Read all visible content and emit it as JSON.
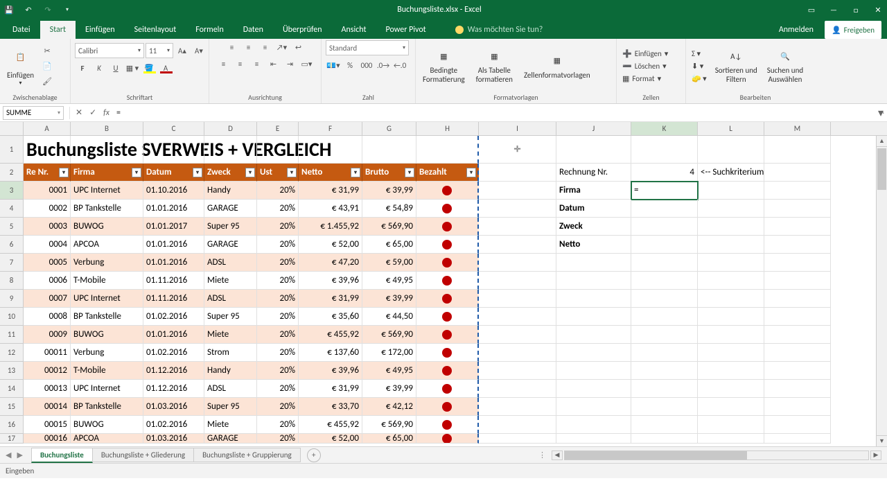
{
  "titlebar": {
    "title": "Buchungsliste.xlsx - Excel"
  },
  "ribbon_tabs": {
    "file": "Datei",
    "tabs": [
      "Start",
      "Einfügen",
      "Seitenlayout",
      "Formeln",
      "Daten",
      "Überprüfen",
      "Ansicht",
      "Power Pivot"
    ],
    "active": "Start",
    "tell_me": "Was möchten Sie tun?",
    "sign_in": "Anmelden",
    "share": "Freigeben"
  },
  "ribbon": {
    "clipboard": {
      "paste": "Einfügen",
      "label": "Zwischenablage"
    },
    "font": {
      "name": "Calibri",
      "size": "11",
      "label": "Schriftart"
    },
    "alignment": {
      "label": "Ausrichtung"
    },
    "number": {
      "format": "Standard",
      "label": "Zahl"
    },
    "styles": {
      "cond": "Bedingte\nFormatierung",
      "table": "Als Tabelle\nformatieren",
      "cell": "Zellenformatvorlagen",
      "label": "Formatvorlagen"
    },
    "cells": {
      "insert": "Einfügen",
      "delete": "Löschen",
      "format": "Format",
      "label": "Zellen"
    },
    "editing": {
      "sort": "Sortieren und\nFiltern",
      "find": "Suchen und\nAuswählen",
      "label": "Bearbeiten"
    }
  },
  "formula_bar": {
    "name": "SUMME",
    "formula": "="
  },
  "columns": [
    "A",
    "B",
    "C",
    "D",
    "E",
    "F",
    "G",
    "H",
    "I",
    "J",
    "K",
    "L",
    "M"
  ],
  "main_title": "Buchungsliste SVERWEIS + VERGLEICH",
  "table_headers": [
    "Re Nr.",
    "Firma",
    "Datum",
    "Zweck",
    "Ust",
    "Netto",
    "Brutto",
    "Bezahlt"
  ],
  "table_rows": [
    {
      "n": "3",
      "nr": "0001",
      "firma": "UPC Internet",
      "datum": "01.10.2016",
      "zweck": "Handy",
      "ust": "20%",
      "netto": "€     31,99",
      "brutto": "€ 39,99",
      "shade": "odd"
    },
    {
      "n": "4",
      "nr": "0002",
      "firma": "BP Tankstelle",
      "datum": "01.01.2016",
      "zweck": "GARAGE",
      "ust": "20%",
      "netto": "€     43,91",
      "brutto": "€ 54,89",
      "shade": "even"
    },
    {
      "n": "5",
      "nr": "0003",
      "firma": "BUWOG",
      "datum": "01.01.2017",
      "zweck": "Super 95",
      "ust": "20%",
      "netto": "€ 1.455,92",
      "brutto": "€ 569,90",
      "shade": "odd"
    },
    {
      "n": "6",
      "nr": "0004",
      "firma": "APCOA",
      "datum": "01.01.2016",
      "zweck": "GARAGE",
      "ust": "20%",
      "netto": "€     52,00",
      "brutto": "€ 65,00",
      "shade": "even"
    },
    {
      "n": "7",
      "nr": "0005",
      "firma": "Verbung",
      "datum": "01.01.2016",
      "zweck": "ADSL",
      "ust": "20%",
      "netto": "€     47,20",
      "brutto": "€ 59,00",
      "shade": "odd"
    },
    {
      "n": "8",
      "nr": "0006",
      "firma": "T-Mobile",
      "datum": "01.11.2016",
      "zweck": "Miete",
      "ust": "20%",
      "netto": "€     39,96",
      "brutto": "€ 49,95",
      "shade": "even"
    },
    {
      "n": "9",
      "nr": "0007",
      "firma": "UPC Internet",
      "datum": "01.11.2016",
      "zweck": "ADSL",
      "ust": "20%",
      "netto": "€     31,99",
      "brutto": "€ 39,99",
      "shade": "odd"
    },
    {
      "n": "10",
      "nr": "0008",
      "firma": "BP Tankstelle",
      "datum": "01.02.2016",
      "zweck": "Super 95",
      "ust": "20%",
      "netto": "€     35,60",
      "brutto": "€ 44,50",
      "shade": "even"
    },
    {
      "n": "11",
      "nr": "0009",
      "firma": "BUWOG",
      "datum": "01.01.2016",
      "zweck": "Miete",
      "ust": "20%",
      "netto": "€   455,92",
      "brutto": "€ 569,90",
      "shade": "odd"
    },
    {
      "n": "12",
      "nr": "00011",
      "firma": "Verbung",
      "datum": "01.02.2016",
      "zweck": "Strom",
      "ust": "20%",
      "netto": "€   137,60",
      "brutto": "€ 172,00",
      "shade": "even"
    },
    {
      "n": "13",
      "nr": "00012",
      "firma": "T-Mobile",
      "datum": "01.12.2016",
      "zweck": "Handy",
      "ust": "20%",
      "netto": "€     39,96",
      "brutto": "€ 49,95",
      "shade": "odd"
    },
    {
      "n": "14",
      "nr": "00013",
      "firma": "UPC Internet",
      "datum": "01.12.2016",
      "zweck": "ADSL",
      "ust": "20%",
      "netto": "€     31,99",
      "brutto": "€ 39,99",
      "shade": "even"
    },
    {
      "n": "15",
      "nr": "00014",
      "firma": "BP Tankstelle",
      "datum": "01.03.2016",
      "zweck": "Super 95",
      "ust": "20%",
      "netto": "€     33,70",
      "brutto": "€ 42,12",
      "shade": "odd"
    },
    {
      "n": "16",
      "nr": "00015",
      "firma": "BUWOG",
      "datum": "01.02.2016",
      "zweck": "Miete",
      "ust": "20%",
      "netto": "€   455,92",
      "brutto": "€ 569,90",
      "shade": "even"
    },
    {
      "n": "17",
      "nr": "00016",
      "firma": "APCOA",
      "datum": "01.03.2016",
      "zweck": "GARAGE",
      "ust": "20%",
      "netto": "€     52,00",
      "brutto": "€ 65,00",
      "shade": "odd"
    }
  ],
  "lookup": {
    "rechnung_label": "Rechnung Nr.",
    "rechnung_value": "4",
    "hint": "<-- Suchkriterium",
    "firma": "Firma",
    "datum": "Datum",
    "zweck": "Zweck",
    "netto": "Netto",
    "formula_display": "="
  },
  "active_cell": "K3",
  "sheets": {
    "tabs": [
      "Buchungsliste",
      "Buchungsliste + Gliederung",
      "Buchungsliste + Gruppierung"
    ],
    "active": 0
  },
  "status": "Eingeben"
}
